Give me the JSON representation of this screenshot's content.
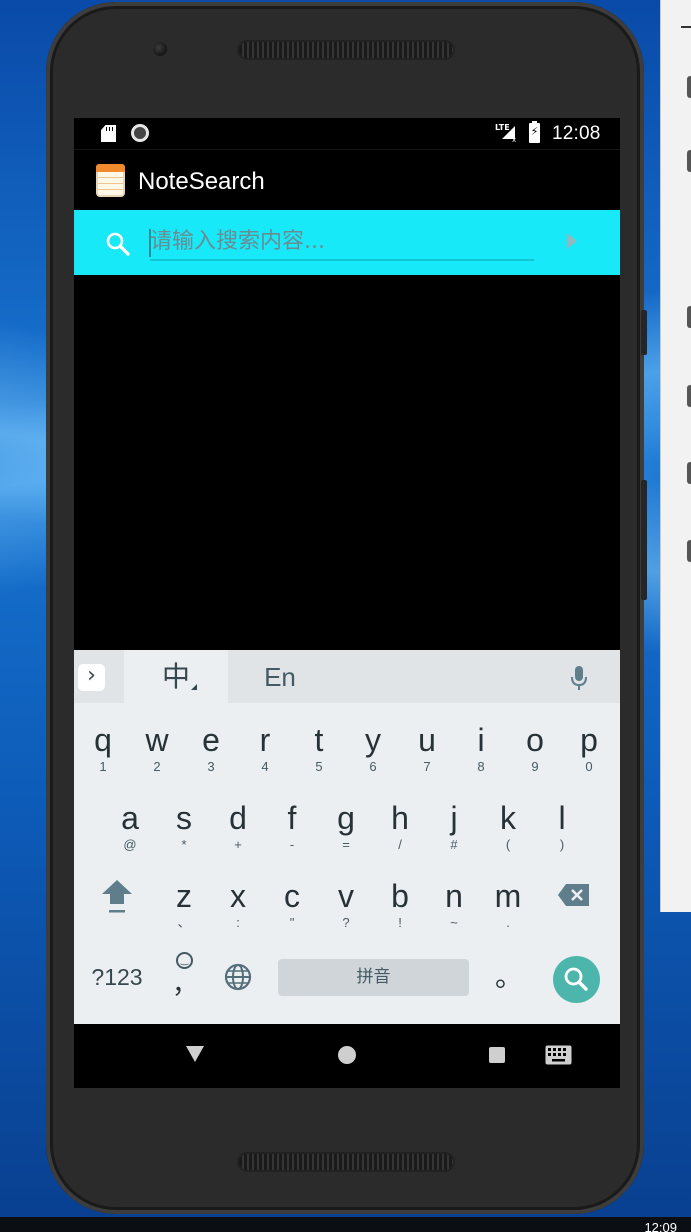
{
  "desktop": {
    "taskbar_clock": "12:09"
  },
  "status_bar": {
    "network_label": "LTE",
    "time": "12:08"
  },
  "app_bar": {
    "title": "NoteSearch",
    "icon": "notepad-app-icon"
  },
  "search": {
    "placeholder": "请输入搜索内容...",
    "value": "",
    "accent_color": "#18e9f8"
  },
  "keyboard": {
    "lang_zh": "中",
    "lang_en": "En",
    "row1": [
      {
        "key": "q",
        "sub": "1"
      },
      {
        "key": "w",
        "sub": "2"
      },
      {
        "key": "e",
        "sub": "3"
      },
      {
        "key": "r",
        "sub": "4"
      },
      {
        "key": "t",
        "sub": "5"
      },
      {
        "key": "y",
        "sub": "6"
      },
      {
        "key": "u",
        "sub": "7"
      },
      {
        "key": "i",
        "sub": "8"
      },
      {
        "key": "o",
        "sub": "9"
      },
      {
        "key": "p",
        "sub": "0"
      }
    ],
    "row2": [
      {
        "key": "a",
        "sub": "@"
      },
      {
        "key": "s",
        "sub": "*"
      },
      {
        "key": "d",
        "sub": "+"
      },
      {
        "key": "f",
        "sub": "-"
      },
      {
        "key": "g",
        "sub": "="
      },
      {
        "key": "h",
        "sub": "/"
      },
      {
        "key": "j",
        "sub": "#"
      },
      {
        "key": "k",
        "sub": "("
      },
      {
        "key": "l",
        "sub": ")"
      }
    ],
    "row3": [
      {
        "key": "z",
        "sub": "、"
      },
      {
        "key": "x",
        "sub": ":"
      },
      {
        "key": "c",
        "sub": "\""
      },
      {
        "key": "v",
        "sub": "?"
      },
      {
        "key": "b",
        "sub": "!"
      },
      {
        "key": "n",
        "sub": "~"
      },
      {
        "key": "m",
        "sub": "."
      }
    ],
    "symbols_label": "?123",
    "emoji_comma": "，",
    "space_label": "拼音",
    "period_label": "。",
    "action_color": "#4db6ac"
  }
}
